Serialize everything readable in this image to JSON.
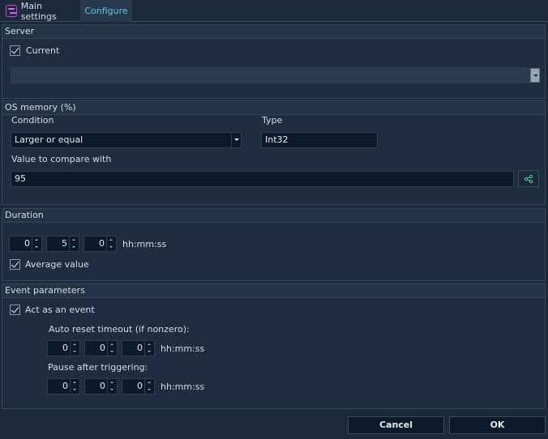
{
  "tabs": {
    "main": "Main settings",
    "configure": "Configure"
  },
  "server": {
    "header": "Server",
    "current_label": "Current",
    "current_checked": true,
    "selected": ""
  },
  "os_memory": {
    "header": "OS memory (%)",
    "condition_label": "Condition",
    "condition_value": "Larger or equal",
    "type_label": "Type",
    "type_value": "Int32",
    "compare_label": "Value to compare with",
    "compare_value": "95"
  },
  "duration": {
    "header": "Duration",
    "h": "0",
    "m": "5",
    "s": "0",
    "unit": "hh:mm:ss",
    "average_label": "Average value",
    "average_checked": true
  },
  "event": {
    "header": "Event parameters",
    "act_label": "Act as an event",
    "act_checked": true,
    "reset_label": "Auto reset timeout (if nonzero):",
    "reset_h": "0",
    "reset_m": "0",
    "reset_s": "0",
    "pause_label": "Pause after triggering:",
    "pause_h": "0",
    "pause_m": "0",
    "pause_s": "0",
    "unit": "hh:mm:ss"
  },
  "footer": {
    "cancel": "Cancel",
    "ok": "OK"
  },
  "colors": {
    "background": "#1c2b3c",
    "accent": "#5fc3e6",
    "field": "#0d1a29"
  },
  "icons": {
    "app": "settings-app-icon",
    "variable": "variable-link-icon"
  }
}
